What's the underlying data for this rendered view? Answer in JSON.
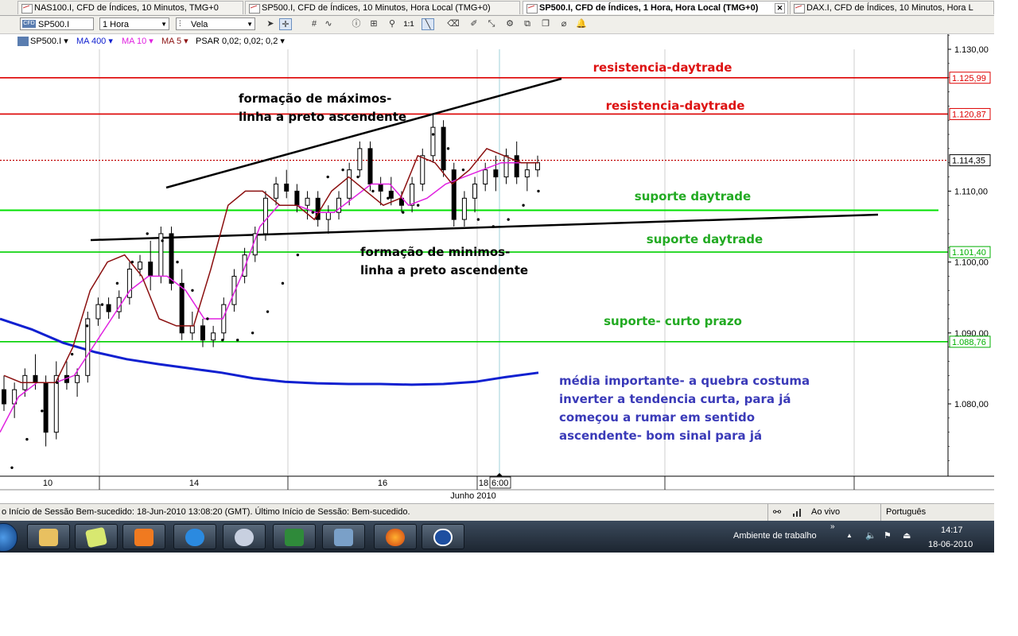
{
  "tabs": [
    {
      "label": "NAS100.I, CFD de Índices, 10 Minutos, TMG+0",
      "active": false
    },
    {
      "label": "SP500.I, CFD de Índices, 10 Minutos, Hora Local (TMG+0)",
      "active": false
    },
    {
      "label": "SP500.I, CFD de Índices, 1 Hora, Hora Local (TMG+0)",
      "active": true
    },
    {
      "label": "DAX.I, CFD de Índices, 10 Minutos, Hora L",
      "active": false
    }
  ],
  "toolbar": {
    "symbol": "SP500.I",
    "symbol_badge": "CFD",
    "timeframe": "1 Hora",
    "chart_type": "Vela",
    "icons": [
      "cursor-icon",
      "crosshair-icon",
      "grid-icon",
      "indicator-icon",
      "info-icon",
      "zoom-in-icon",
      "zoom-reset-icon",
      "draw-line-icon",
      "eraser-icon",
      "move-icon",
      "settings-icon",
      "copy-icon",
      "clone-icon",
      "attach-icon",
      "alert-bell-icon"
    ]
  },
  "legend": {
    "symbol": "SP500.I",
    "ma400": "MA 400",
    "ma10": "MA 10",
    "ma5": "MA 5",
    "psar": "PSAR 0,02; 0,02; 0,2"
  },
  "chart_data": {
    "type": "candlestick",
    "symbol": "SP500.I",
    "timeframe": "1 Hora",
    "ylim": [
      1070.2,
      1132.5
    ],
    "y_ticks": [
      "1.130,00",
      "1.110,00",
      "1.100,00",
      "1.090,00",
      "1.080,00"
    ],
    "x_ticks": [
      "10",
      "14",
      "16",
      "18",
      "6:00"
    ],
    "x_axis_label": "Junho 2010",
    "price_tags": [
      {
        "label": "1.125,99",
        "value": 1125.99,
        "color": "#dd0000"
      },
      {
        "label": "1.120,87",
        "value": 1120.87,
        "color": "#dd0000"
      },
      {
        "label": "1.114,35",
        "value": 1114.35,
        "color": "#000000"
      },
      {
        "label": "1.101,40",
        "value": 1101.4,
        "color": "#00b000"
      },
      {
        "label": "1.088,76",
        "value": 1088.76,
        "color": "#00b000"
      }
    ],
    "horizontal_lines": [
      {
        "value": 1125.99,
        "color": "#dd0000",
        "text": "resistencia-daytrade",
        "text_color": "#dd1111"
      },
      {
        "value": 1120.87,
        "color": "#dd0000",
        "text": "resistencia-daytrade",
        "text_color": "#dd1111"
      },
      {
        "value": 1107.3,
        "color": "#00e000",
        "text": "suporte daytrade",
        "text_color": "#22aa22"
      },
      {
        "value": 1101.4,
        "color": "#00d000",
        "text": "suporte daytrade",
        "text_color": "#22aa22"
      },
      {
        "value": 1088.76,
        "color": "#00d000",
        "text": "suporte- curto prazo",
        "text_color": "#22aa22"
      }
    ],
    "last_price": 1114.35,
    "trendlines": [
      {
        "name": "resistance-trendline",
        "from": [
          0,
          1110.6
        ],
        "to": [
          1,
          1126.1
        ]
      },
      {
        "name": "support-trendline",
        "from": [
          0,
          1103.3
        ],
        "to": [
          1,
          1106.5
        ]
      }
    ],
    "annotations": [
      {
        "lines": [
          "formação de máximos-",
          "linha a preto ascendente"
        ],
        "color": "#000000"
      },
      {
        "lines": [
          "formação de minimos-",
          "linha a preto ascendente"
        ],
        "color": "#000000"
      },
      {
        "lines": [
          "média importante- a quebra costuma",
          "inverter a tendencia curta, para já",
          "começou a rumar em sentido",
          "ascendente- bom sinal para já"
        ],
        "color": "#3a3ab8"
      }
    ],
    "series": [
      {
        "name": "MA 400",
        "color": "#1020d0",
        "values": [
          1092.0,
          1090.5,
          1088.6,
          1087.3,
          1086.3,
          1085.6,
          1085.0,
          1084.4,
          1083.6,
          1083.1,
          1082.9,
          1082.8,
          1082.8,
          1082.7,
          1082.8,
          1083.1,
          1083.8,
          1084.4
        ]
      },
      {
        "name": "MA 10",
        "color": "#e020e0",
        "values": [
          1076,
          1081,
          1083,
          1083,
          1084,
          1088,
          1092,
          1096,
          1098,
          1098,
          1096,
          1092,
          1092,
          1098,
          1105,
          1108,
          1108,
          1107,
          1107,
          1109,
          1111,
          1111,
          1108,
          1109,
          1111,
          1112,
          1113,
          1114,
          1114,
          1114
        ]
      },
      {
        "name": "MA 5",
        "color": "#8b1010",
        "values": [
          1084,
          1083,
          1083,
          1083,
          1088,
          1096,
          1100,
          1101,
          1098,
          1092,
          1091,
          1091,
          1099,
          1108,
          1110,
          1110,
          1108,
          1108,
          1106,
          1110,
          1112,
          1110,
          1108,
          1109,
          1115,
          1114,
          1111,
          1113,
          1116,
          1115,
          1114,
          1114
        ]
      },
      {
        "name": "PSAR",
        "color": "#000000",
        "values": [
          1071,
          1075,
          1079,
          1083,
          1087,
          1091,
          1094,
          1097,
          1100,
          1104,
          1103,
          1100,
          1096,
          1092,
          1089,
          1089,
          1090,
          1093,
          1097,
          1101,
          1107,
          1112,
          1113,
          1112,
          1110,
          1109,
          1107,
          1108,
          1118,
          1116,
          1113,
          1106,
          1105,
          1106,
          1108,
          1110
        ]
      }
    ],
    "candles": [
      [
        1082,
        1084,
        1079,
        1080
      ],
      [
        1080,
        1083,
        1078,
        1082
      ],
      [
        1082,
        1085,
        1081,
        1084
      ],
      [
        1084,
        1087,
        1082,
        1083
      ],
      [
        1083,
        1084,
        1074,
        1076
      ],
      [
        1076,
        1086,
        1075,
        1084
      ],
      [
        1084,
        1086,
        1082,
        1083
      ],
      [
        1083,
        1085,
        1081,
        1084
      ],
      [
        1084,
        1093,
        1083,
        1092
      ],
      [
        1092,
        1095,
        1091,
        1094
      ],
      [
        1094,
        1095,
        1092,
        1093
      ],
      [
        1093,
        1096,
        1092,
        1095
      ],
      [
        1095,
        1100,
        1094,
        1099
      ],
      [
        1099,
        1101,
        1098,
        1100
      ],
      [
        1100,
        1103,
        1096,
        1098
      ],
      [
        1098,
        1105,
        1097,
        1104
      ],
      [
        1104,
        1105,
        1096,
        1097
      ],
      [
        1097,
        1099,
        1089,
        1090
      ],
      [
        1090,
        1093,
        1089,
        1091
      ],
      [
        1091,
        1092,
        1088,
        1089
      ],
      [
        1089,
        1091,
        1088,
        1090
      ],
      [
        1090,
        1095,
        1089,
        1094
      ],
      [
        1094,
        1099,
        1093,
        1098
      ],
      [
        1098,
        1102,
        1097,
        1101
      ],
      [
        1101,
        1105,
        1100,
        1104
      ],
      [
        1104,
        1110,
        1103,
        1109
      ],
      [
        1109,
        1112,
        1108,
        1111
      ],
      [
        1111,
        1113,
        1109,
        1110
      ],
      [
        1110,
        1111,
        1107,
        1108
      ],
      [
        1108,
        1110,
        1106,
        1109
      ],
      [
        1109,
        1110,
        1105,
        1106
      ],
      [
        1106,
        1108,
        1104,
        1107
      ],
      [
        1107,
        1110,
        1106,
        1109
      ],
      [
        1109,
        1114,
        1108,
        1113
      ],
      [
        1113,
        1117,
        1112,
        1116
      ],
      [
        1116,
        1117,
        1110,
        1111
      ],
      [
        1111,
        1112,
        1108,
        1110
      ],
      [
        1110,
        1112,
        1108,
        1109
      ],
      [
        1109,
        1110,
        1107,
        1108
      ],
      [
        1108,
        1112,
        1107,
        1111
      ],
      [
        1111,
        1116,
        1110,
        1115
      ],
      [
        1115,
        1121,
        1114,
        1119
      ],
      [
        1119,
        1120,
        1112,
        1113
      ],
      [
        1113,
        1114,
        1105,
        1106
      ],
      [
        1106,
        1110,
        1105,
        1109
      ],
      [
        1109,
        1112,
        1107,
        1111
      ],
      [
        1111,
        1114,
        1110,
        1113
      ],
      [
        1113,
        1115,
        1110,
        1112
      ],
      [
        1112,
        1116,
        1111,
        1115
      ],
      [
        1115,
        1117,
        1111,
        1112
      ],
      [
        1112,
        1114,
        1110,
        1113
      ],
      [
        1113,
        1115,
        1112,
        1114
      ]
    ]
  },
  "statusbar": {
    "message": "o Início de Sessão Bem-sucedido: 18-Jun-2010 13:08:20 (GMT). Último Início de Sessão: Bem-sucedido.",
    "live": "Ao vivo",
    "language": "Português"
  },
  "taskbar": {
    "apps": [
      "file-explorer",
      "notes",
      "media-player",
      "internet-explorer",
      "paint",
      "excel",
      "network",
      "firefox",
      "trading-b"
    ],
    "desktop_label": "Ambiente de trabalho",
    "more": "»",
    "time": "14:17",
    "date": "18-06-2010"
  }
}
